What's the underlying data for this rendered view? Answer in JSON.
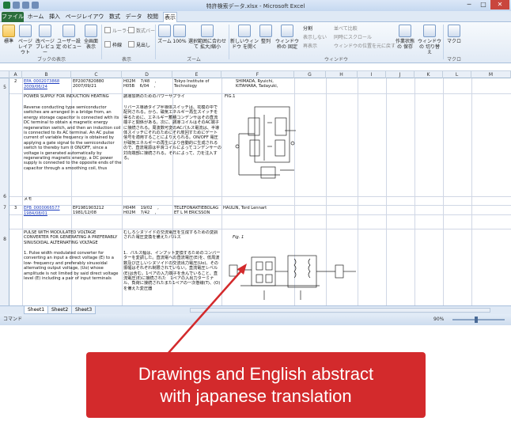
{
  "window": {
    "title": "特許検索データ.xlsx - Microsoft Excel",
    "controls": [
      "─",
      "□",
      "✕"
    ]
  },
  "ribbon_tabs": [
    "ファイル",
    "ホーム",
    "挿入",
    "ページレイアウト",
    "数式",
    "データ",
    "校閲",
    "表示"
  ],
  "ribbon": {
    "buttons": [
      "標準",
      "ページ\nレイアウト",
      "改ページ\nプレビュー",
      "ユーザー設定\nのビュー",
      "全画面\n表示",
      "ズーム",
      "100%",
      "選択範囲に合わせて\n拡大/縮小",
      "新しいウィンドウ\nを開く",
      "整列",
      "ウィンドウ枠の\n固定",
      "作業状態の\n保存",
      "ウィンドウの\n切り替え",
      "マクロ"
    ],
    "checks": [
      "ルーラー",
      "数式バー",
      "枠線",
      "見出し"
    ],
    "small": [
      "分割",
      "表示しない",
      "再表示",
      "並べて比較",
      "同時にスクロール",
      "ウィンドウの位置を元に戻す"
    ],
    "groups": [
      "ブックの表示",
      "表示",
      "ズーム",
      "ウィンドウ",
      "マクロ"
    ]
  },
  "columns": [
    "A",
    "B",
    "C",
    "D",
    "E",
    "F",
    "G",
    "H",
    "I",
    "J",
    "K",
    "L",
    "M"
  ],
  "row_headers": [
    "5",
    "6",
    "7",
    "8"
  ],
  "rows": [
    {
      "index": "2",
      "links": [
        "EPA_0002073868",
        "2009/06/24"
      ],
      "app_no": "EP2007820880\n2007/09/21",
      "ipc": "H02M    7/48    ,\nH05B    6/04    ,",
      "applicant": "Tokyo Institute of\nTechnology",
      "inventor": "SHIMADA, Ryuichi,\nKITAHARA, Tadayuki,",
      "title_en": "POWER SUPPLY FOR INDUCTION HEATING",
      "abstract_en": "Reverse conducting type semiconductor switches are arranged in a bridge from, an energy storage capacitor is connected with its DC terminal to obtain a magnetic energy regeneration switch, and then an induction coil is connected to its AC terminal. An AC pulse current of variable frequency is obtained by applying a gate signal to the semiconductor switch to thereby turn it ON/OFF, since a voltage is generated automatically by regenerating magnetic energy, a DC power supply is connected to the opposite ends of the capacitor through a smoothing coil, thus",
      "title_ja": "誘導加熱のためのパワーサプライ",
      "abstract_ja": "リバース導通タイプ半導体スイッチは、花模の中で配列される。から、磁気エネルギー再生スイッチを得るために、エネルギー蓄積コンデンサはその直流端子と関係がある。次に、誘導コイルはそのAC端子に接続される。周波数可変のACパルス電流は、半導体スイッチにそれのためにそれ炭回すためにゲート信号を適用することによりえられる。ON/OFF 電圧が磁気エネルギーの再生により自動的に生成されるので、直流電源は平滑コイルによってコンデンサーの対向端部に接続される。それによって、力を注入する。",
      "fig_label": "FIG.1",
      "memo": "メモ"
    },
    {
      "index": "3",
      "links": [
        "EPB_0000066577",
        "1984/08/01"
      ],
      "app_no": "EP1981903212\n1981/12/08",
      "ipc": "H04M    19/02    ,\nH02M    7/42    ,",
      "applicant": "TELEFONAKTIEBOLAG\nET L M ERICSSON",
      "inventor": "HAULIN, Tord Lennart",
      "title_en": "PULSE WITH MODULATED VOLTAGE CONVERTER FOR GENERATING A PREFERABLY SINUSOIDAL ALTERNATING VOLTAGE",
      "abstract_en": "1. Pulse width modulated converter for converting an input a direct voltage (E) to a low- frequency and preferably sinusoidal alternating output voltage, (Uo) whose amplitude is not limited by said direct voltage level (E) including a pair of input terminals",
      "title_ja": "むしろシヌソイドの交流電圧を生成するための変調された電圧変換を備えたパルス",
      "abstract_ja": "1．パルス幅は、インプット変換するためのコンバーターを変調した。直流電への直流電圧(E)を、低周波数及び正しいシヌソイドの交流出力電圧(Uo)、その振幅はそれぞれ制限されていない。直流電圧レベル(E)は含む。1ペアの入力端子を含んでいること、直流電圧(E)に接続された　1ペアの入出力ターミナル、負荷に接続されたまた1ペアの一次巻線(T)、(O)を備えた変圧器",
      "fig_label": "Fig. 1"
    }
  ],
  "sheet_tabs": [
    "Sheet1",
    "Sheet2",
    "Sheet3"
  ],
  "status": {
    "mode": "コマンド",
    "zoom": "90%"
  },
  "callout": {
    "line1": "Drawings and English abstract",
    "line2": "with japanese translation"
  },
  "colors": {
    "callout": "#d32a2c",
    "file_tab": "#2a6e3c",
    "link": "#1f3fbf"
  }
}
